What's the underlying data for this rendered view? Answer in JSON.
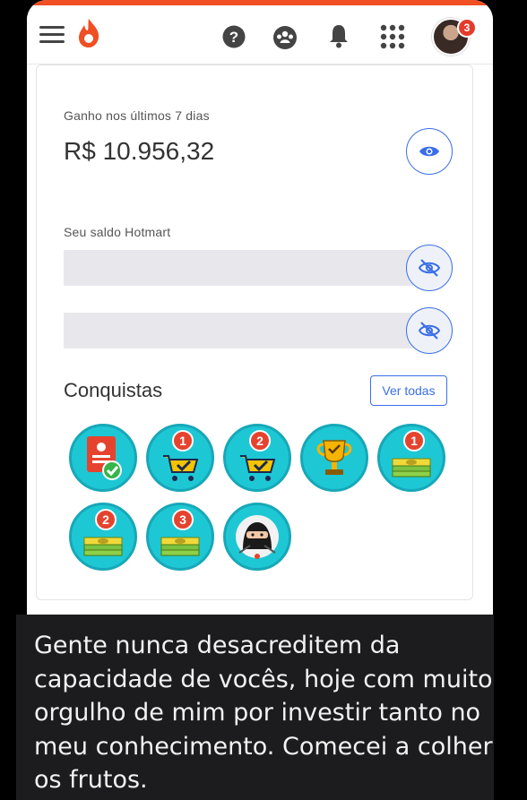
{
  "header": {
    "icons": [
      "menu-icon",
      "hotmart-flame-icon",
      "help-icon",
      "community-icon",
      "bell-icon",
      "apps-grid-icon"
    ],
    "notification_count": "3",
    "brand_color": "#f04e23"
  },
  "earnings": {
    "label": "Ganho nos últimos 7 dias",
    "value": "R$ 10.956,32"
  },
  "balance": {
    "label": "Seu saldo Hotmart"
  },
  "achievements": {
    "title": "Conquistas",
    "see_all_label": "Ver todas",
    "badges": [
      {
        "icon": "profile-check-badge",
        "number": ""
      },
      {
        "icon": "cart-badge",
        "number": "1"
      },
      {
        "icon": "cart-badge",
        "number": "2"
      },
      {
        "icon": "trophy-badge",
        "number": ""
      },
      {
        "icon": "money-badge",
        "number": "1"
      },
      {
        "icon": "money-badge",
        "number": "2"
      },
      {
        "icon": "money-badge",
        "number": "3"
      },
      {
        "icon": "ninja-badge",
        "number": ""
      }
    ]
  },
  "caption": {
    "text": "Gente nunca desacreditem da capacidade de vocês, hoje com muito orgulho de mim por investir tanto no meu conhecimento. Comecei a colher os frutos."
  },
  "colors": {
    "accent": "#3a6ee8",
    "badge_teal": "#1ec7d4",
    "badge_red": "#e5432e"
  }
}
